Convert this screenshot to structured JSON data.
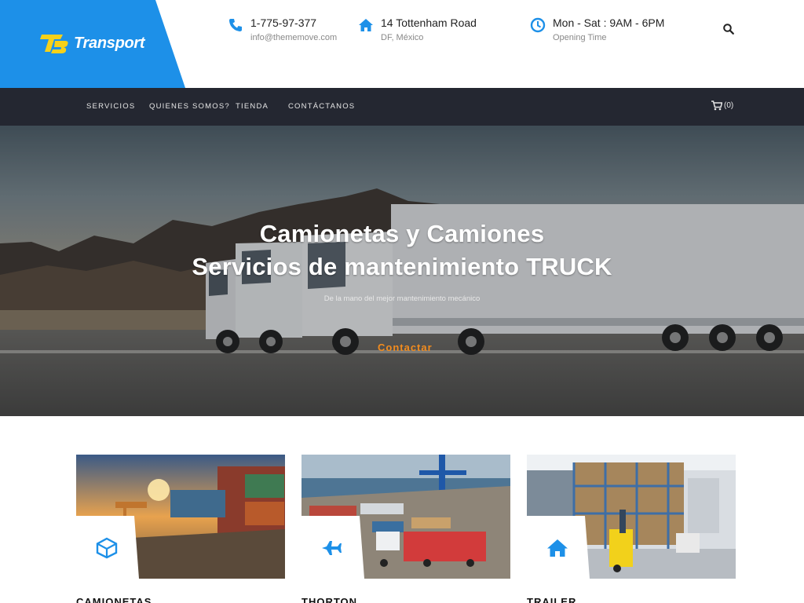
{
  "brand": {
    "name": "Transport"
  },
  "contact": {
    "phone": "1-775-97-377",
    "email": "info@thememove.com",
    "address": "14 Tottenham Road",
    "city": "DF, México",
    "hours": "Mon - Sat : 9AM - 6PM",
    "hours_label": "Opening Time"
  },
  "nav": {
    "items": [
      "SERVICIOS",
      "QUIENES SOMOS?",
      "TIENDA",
      "CONTÁCTANOS"
    ],
    "cart_count": "(0)"
  },
  "hero": {
    "title_line1": "Camionetas y Camiones",
    "title_line2": "Servicios de mantenimiento TRUCK",
    "subtitle": "De la mano del mejor mantenimiento mecánico",
    "cta": "Contactar"
  },
  "services": [
    {
      "title": "CAMIONETAS",
      "icon": "box-icon"
    },
    {
      "title": "THORTON",
      "icon": "plane-icon"
    },
    {
      "title": "TRAILER",
      "icon": "home-icon"
    }
  ],
  "colors": {
    "accent": "#1d90e8",
    "nav_bg": "#242731",
    "cta": "#f28c1e"
  }
}
